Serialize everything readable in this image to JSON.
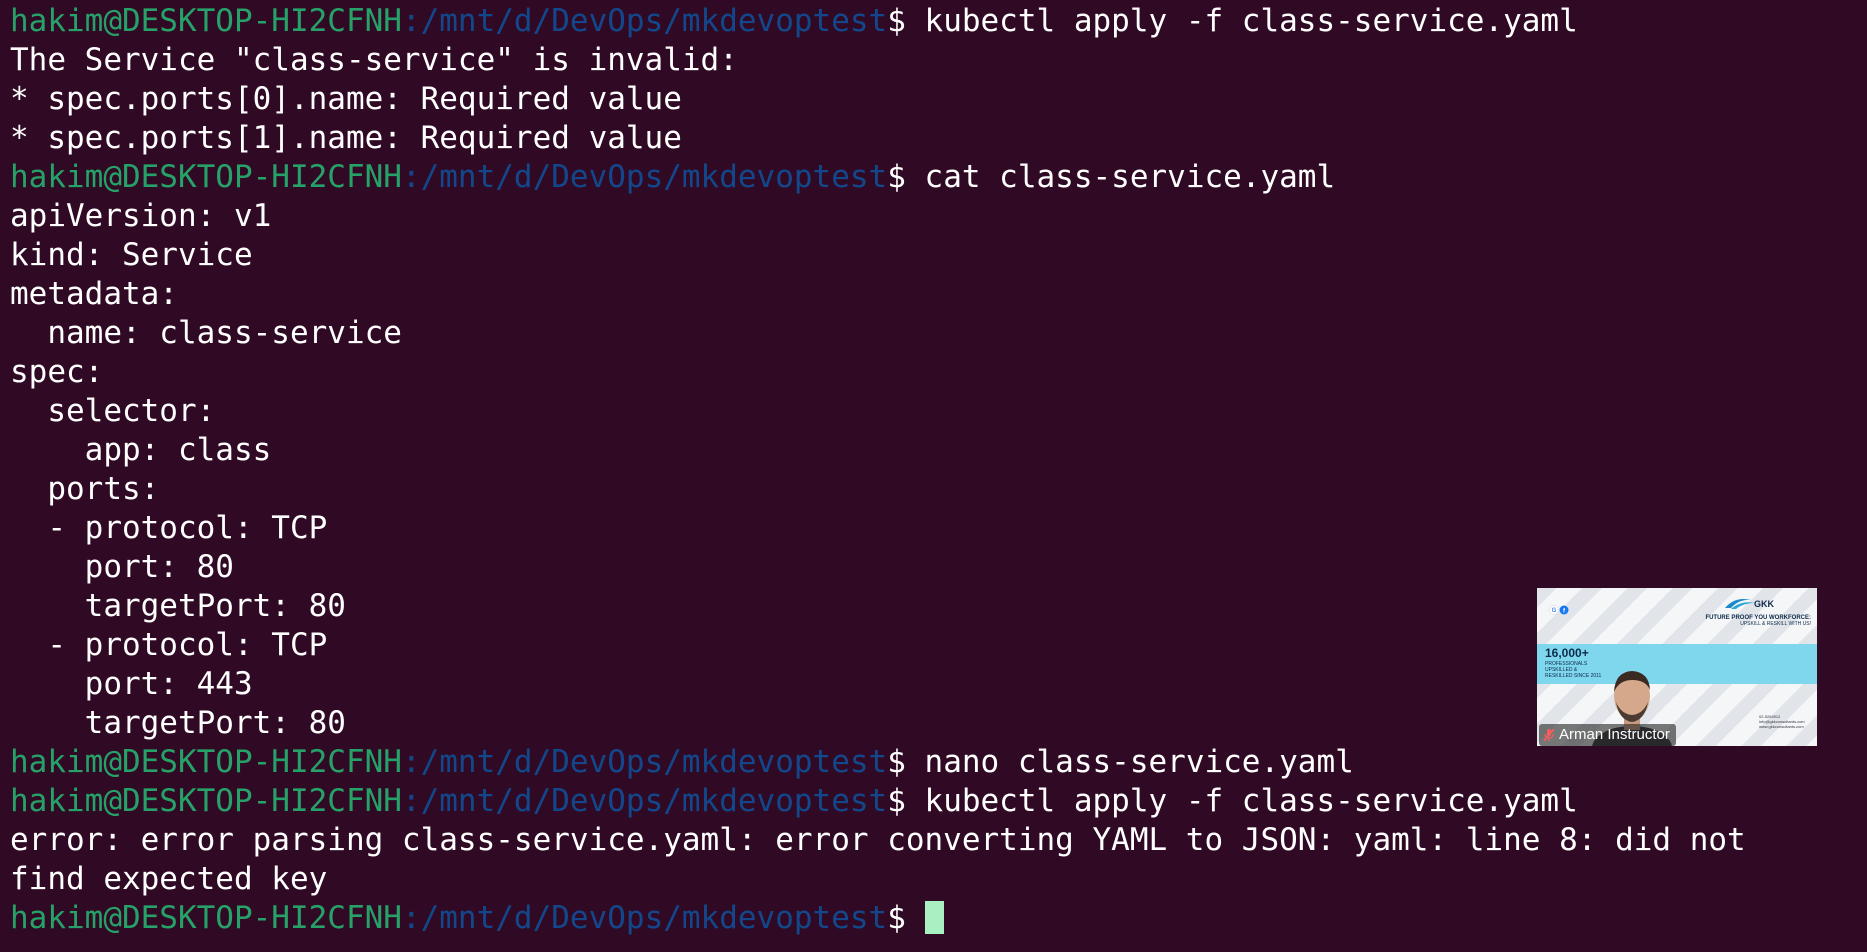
{
  "prompt": {
    "user_host": "hakim@DESKTOP-HI2CFNH",
    "path": ":/mnt/d/DevOps/mkdevoptest",
    "symbol": "$ "
  },
  "lines": [
    {
      "kind": "prompt",
      "command": "kubectl apply -f class-service.yaml"
    },
    {
      "kind": "output",
      "text": "The Service \"class-service\" is invalid:"
    },
    {
      "kind": "output",
      "text": "* spec.ports[0].name: Required value"
    },
    {
      "kind": "output",
      "text": "* spec.ports[1].name: Required value"
    },
    {
      "kind": "prompt",
      "command": "cat class-service.yaml"
    },
    {
      "kind": "output",
      "text": "apiVersion: v1"
    },
    {
      "kind": "output",
      "text": "kind: Service"
    },
    {
      "kind": "output",
      "text": "metadata:"
    },
    {
      "kind": "output",
      "text": "  name: class-service"
    },
    {
      "kind": "output",
      "text": "spec:"
    },
    {
      "kind": "output",
      "text": "  selector:"
    },
    {
      "kind": "output",
      "text": "    app: class"
    },
    {
      "kind": "output",
      "text": "  ports:"
    },
    {
      "kind": "output",
      "text": "  - protocol: TCP"
    },
    {
      "kind": "output",
      "text": "    port: 80"
    },
    {
      "kind": "output",
      "text": "    targetPort: 80"
    },
    {
      "kind": "output",
      "text": "  - protocol: TCP"
    },
    {
      "kind": "output",
      "text": "    port: 443"
    },
    {
      "kind": "output",
      "text": "    targetPort: 80"
    },
    {
      "kind": "prompt",
      "command": "nano class-service.yaml"
    },
    {
      "kind": "prompt",
      "command": "kubectl apply -f class-service.yaml"
    },
    {
      "kind": "output",
      "text": "error: error parsing class-service.yaml: error converting YAML to JSON: yaml: line 8: did not"
    },
    {
      "kind": "output",
      "text": "find expected key"
    },
    {
      "kind": "prompt_active",
      "command": ""
    }
  ],
  "video_overlay": {
    "participant_name": "Arman Instructor",
    "slide": {
      "stat": "16,000+",
      "stat_caption": "PROFESSIONALS UPSKILLED & RESKILLED SINCE 2011",
      "headline": "FUTURE PROOF YOU WORKFORCE:",
      "subheadline": "UPSKILL & RESKILL WITH US!",
      "logo_text": "GKK",
      "contact_lines": [
        "02-5264912",
        "info@gkkconsultants.com",
        "www.gkkconsultants.com"
      ]
    },
    "mic_icon": "mic-muted-icon"
  },
  "colors": {
    "background": "#300a24",
    "user_host": "#26a269",
    "path": "#12488b",
    "text": "#ffffff",
    "cursor": "#a8f0c2"
  }
}
